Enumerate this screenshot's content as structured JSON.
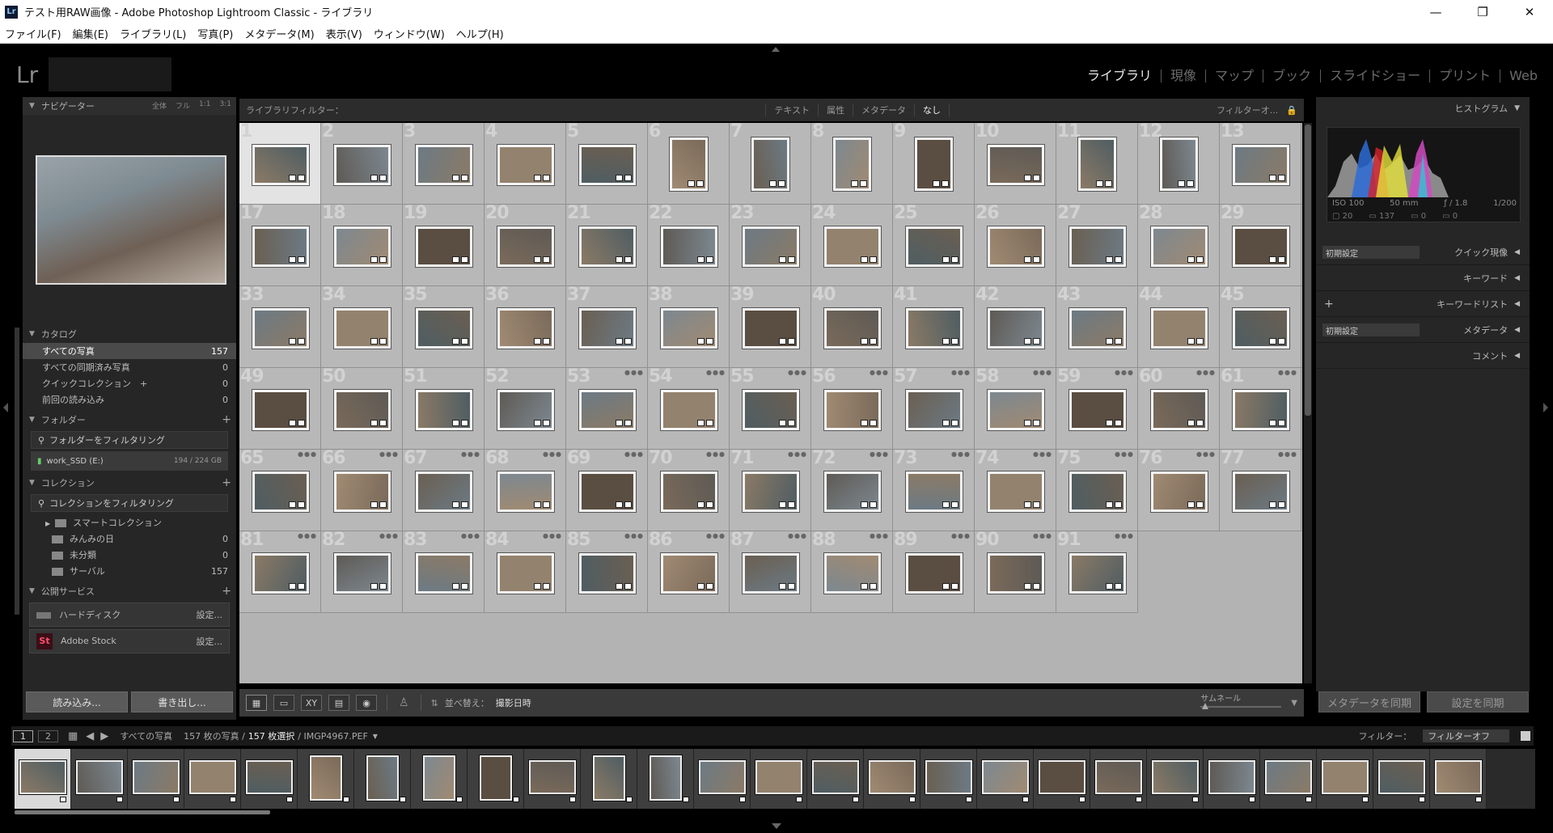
{
  "titlebar": {
    "app_icon": "Lr",
    "title": "テスト用RAW画像 - Adobe Photoshop Lightroom Classic - ライブラリ",
    "min_icon": "minimize-icon",
    "max_icon": "restore-icon",
    "close_icon": "close-icon",
    "min_glyph": "—",
    "max_glyph": "❐",
    "close_glyph": "✕"
  },
  "menubar": [
    "ファイル(F)",
    "編集(E)",
    "ライブラリ(L)",
    "写真(P)",
    "メタデータ(M)",
    "表示(V)",
    "ウィンドウ(W)",
    "ヘルプ(H)"
  ],
  "identity": {
    "logo": "Lr"
  },
  "modules": [
    {
      "label": "ライブラリ",
      "active": true
    },
    {
      "label": "現像",
      "active": false
    },
    {
      "label": "マップ",
      "active": false
    },
    {
      "label": "ブック",
      "active": false
    },
    {
      "label": "スライドショー",
      "active": false
    },
    {
      "label": "プリント",
      "active": false
    },
    {
      "label": "Web",
      "active": false
    }
  ],
  "left": {
    "navigator": {
      "title": "ナビゲーター",
      "opts": [
        "全体",
        "フル",
        "1:1",
        "3:1"
      ]
    },
    "catalog": {
      "title": "カタログ",
      "rows": [
        {
          "label": "すべての写真",
          "count": "157",
          "selected": true
        },
        {
          "label": "すべての同期済み写真",
          "count": "0",
          "selected": false
        },
        {
          "label": "クイックコレクション　+",
          "count": "0",
          "selected": false
        },
        {
          "label": "前回の読み込み",
          "count": "0",
          "selected": false
        }
      ]
    },
    "folders": {
      "title": "フォルダー",
      "filter": "フォルダーをフィルタリング",
      "volume": "work_SSD (E:)",
      "volume_size": "194 / 224 GB"
    },
    "collections": {
      "title": "コレクション",
      "filter": "コレクションをフィルタリング",
      "rows": [
        {
          "label": "スマートコレクション",
          "count": ""
        },
        {
          "label": "みんみの日",
          "count": "0"
        },
        {
          "label": "未分類",
          "count": "0"
        },
        {
          "label": "サーバル",
          "count": "157"
        }
      ]
    },
    "publish": {
      "title": "公開サービス",
      "rows": [
        {
          "label": "ハードディスク",
          "action": "設定..."
        },
        {
          "label": "Adobe Stock",
          "action": "設定..."
        }
      ],
      "stock_icon": "St"
    },
    "import_btn": "読み込み...",
    "export_btn": "書き出し..."
  },
  "filterbar": {
    "title": "ライブラリフィルター：",
    "tabs": [
      "テキスト",
      "属性",
      "メタデータ",
      "なし"
    ],
    "preset": "フィルターオ...",
    "lock_icon": "lock-icon"
  },
  "grid": {
    "count": 91,
    "portrait_indices": [
      6,
      7,
      8,
      9,
      11,
      12
    ],
    "selected_index": 1,
    "colors": [
      "#7a6a5a",
      "#8b7a66",
      "#5e5a55",
      "#6c7a84",
      "#93826e",
      "#4f5d62",
      "#a08a72",
      "#6a5f52",
      "#7d8890",
      "#5a4d41"
    ]
  },
  "toolbar": {
    "sort_label": "並べ替え：",
    "sort_value": "撮影日時",
    "thumbnail_label": "サムネール",
    "grid_icon": "grid-view-icon",
    "loupe_icon": "loupe-view-icon",
    "compare_icon": "compare-view-icon",
    "survey_icon": "survey-view-icon",
    "people_icon": "people-view-icon",
    "painter_icon": "painter-icon",
    "sort_icon": "sort-direction-icon",
    "xy_label": "XY"
  },
  "right": {
    "histogram_title": "ヒストグラム",
    "iso": "ISO 100",
    "focal": "50 mm",
    "aperture": "ƒ / 1.8",
    "shutter": "1/200",
    "hist_a": "20",
    "hist_b": "137",
    "hist_c": "0",
    "hist_d": "0",
    "quick_develop": "クイック現像",
    "quick_preset": "初期設定",
    "keywords": "キーワード",
    "keyword_list": "キーワードリスト",
    "metadata": "メタデータ",
    "metadata_preset": "初期設定",
    "comments": "コメント",
    "sync_meta": "メタデータを同期",
    "sync_settings": "設定を同期"
  },
  "filmstrip": {
    "page1": "1",
    "page2": "2",
    "source": "すべての写真",
    "info": "157 枚の写真 /",
    "selected": "157 枚選択",
    "filename": "/ IMGP4967.PEF",
    "filter_label": "フィルター：",
    "filter_value": "フィルターオフ",
    "count": 26,
    "portrait_indices": [
      6,
      7,
      8,
      9,
      11,
      12
    ],
    "selected_index": 1
  }
}
